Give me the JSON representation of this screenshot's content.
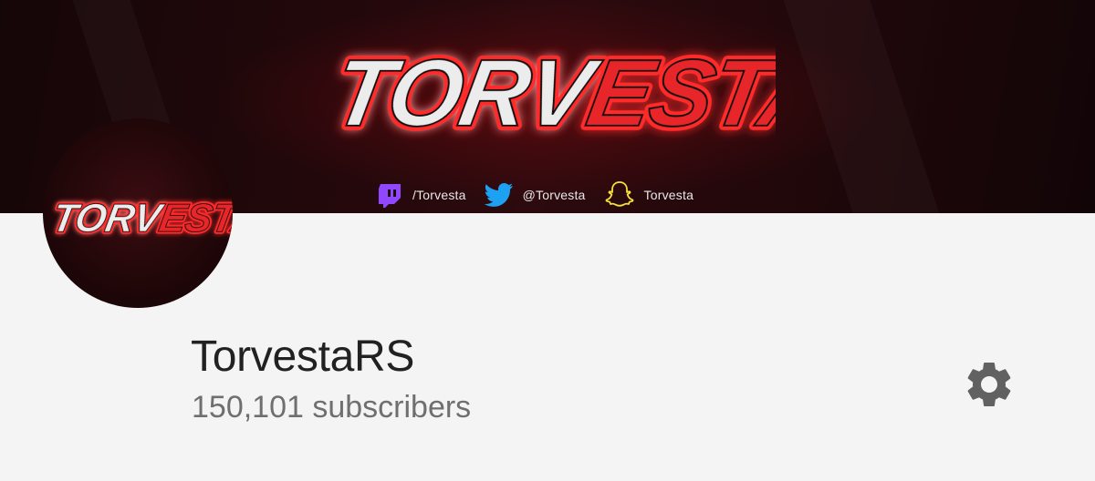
{
  "banner": {
    "logo_text_light": "TORV",
    "logo_text_red": "ESTA",
    "socials": [
      {
        "icon": "twitch-icon",
        "label": "/Torvesta",
        "color": "#9146ff"
      },
      {
        "icon": "twitter-icon",
        "label": "@Torvesta",
        "color": "#1da1f2"
      },
      {
        "icon": "snapchat-icon",
        "label": "Torvesta",
        "color": "#f5e23a"
      }
    ]
  },
  "avatar": {
    "logo_text_light": "TORV",
    "logo_text_red": "ESTA"
  },
  "channel": {
    "name": "TorvestaRS",
    "subscribers": "150,101 subscribers"
  },
  "actions": {
    "settings_icon": "gear-icon"
  },
  "colors": {
    "background": "#f4f4f4",
    "title": "#212121",
    "subtitle": "#6f6f6f",
    "gear": "#616161",
    "brand_red": "#e8262b",
    "banner_dark": "#1c0709"
  }
}
